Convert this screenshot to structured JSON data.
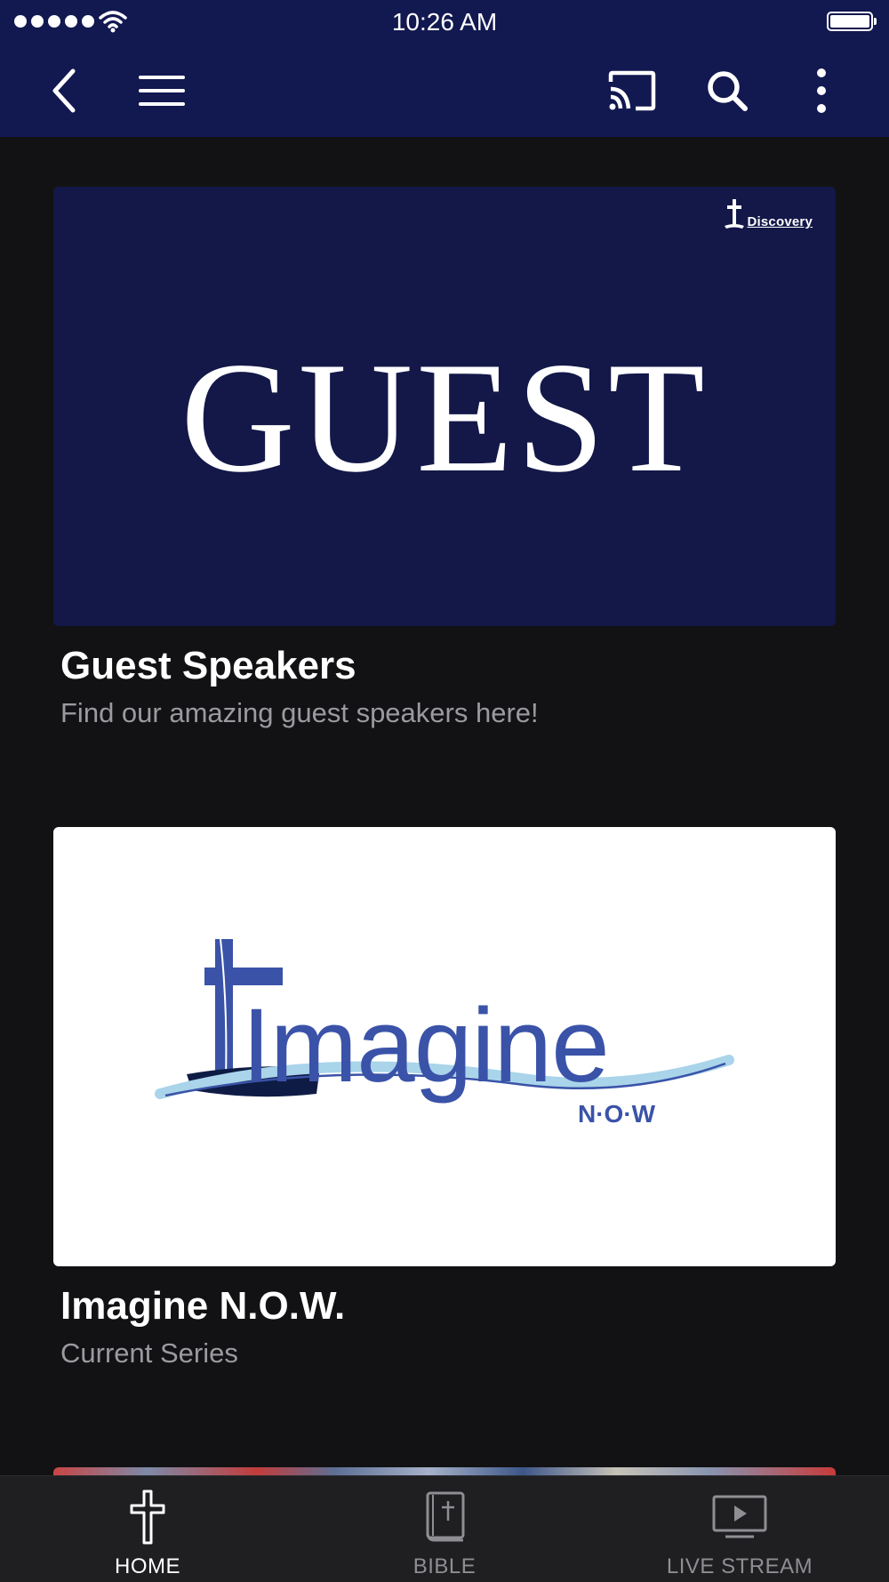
{
  "status_bar": {
    "time": "10:26 AM"
  },
  "toolbar": {
    "back_icon": "chevron-left-icon",
    "menu_icon": "hamburger-menu-icon",
    "cast_icon": "cast-icon",
    "search_icon": "search-icon",
    "more_icon": "more-vertical-icon"
  },
  "cards": [
    {
      "image_text": "GUEST",
      "logo_text": "Discovery",
      "title": "Guest Speakers",
      "subtitle": "Find our amazing guest speakers here!"
    },
    {
      "image_text": "Imagine",
      "image_subtext": "N·O·W",
      "title": "Imagine N.O.W.",
      "subtitle": "Current Series"
    }
  ],
  "tabs": [
    {
      "label": "HOME",
      "icon": "cross-icon",
      "active": true
    },
    {
      "label": "BIBLE",
      "icon": "bible-icon",
      "active": false
    },
    {
      "label": "LIVE STREAM",
      "icon": "play-screen-icon",
      "active": false
    }
  ],
  "colors": {
    "header": "#121850",
    "background": "#121214",
    "tab_active": "#ffffff",
    "tab_inactive": "#8e8e93",
    "imagine_blue": "#3a53a8",
    "imagine_navy": "#0e1c45",
    "imagine_light": "#a9d4ea"
  }
}
